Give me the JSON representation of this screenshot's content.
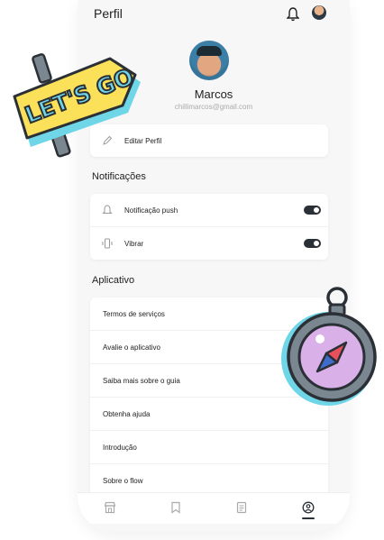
{
  "header": {
    "title": "Perfil"
  },
  "profile": {
    "name": "Marcos",
    "email": "chillimarcos@gmail.com"
  },
  "actions": {
    "edit_label": "Editar Perfil"
  },
  "notifications": {
    "section_title": "Notificações",
    "items": [
      {
        "label": "Notificação push",
        "enabled": true
      },
      {
        "label": "Vibrar",
        "enabled": true
      }
    ]
  },
  "app": {
    "section_title": "Aplicativo",
    "items": [
      {
        "label": "Termos de serviços"
      },
      {
        "label": "Avalie o aplicativo"
      },
      {
        "label": "Saiba mais sobre o guia"
      },
      {
        "label": "Obtenha ajuda"
      },
      {
        "label": "Introdução"
      },
      {
        "label": "Sobre o flow"
      }
    ]
  },
  "stickers": {
    "lets_go_text": "LET'S GO"
  },
  "nav": {
    "items": [
      "store-icon",
      "bookmark-icon",
      "document-icon",
      "profile-icon"
    ],
    "active": "profile-icon"
  },
  "colors": {
    "background": "#f7f7f8",
    "toggle": "#2b2f36",
    "sticker_yellow": "#fbe05a",
    "sticker_cyan": "#6fd6e8",
    "compass_face": "#d9b1e8"
  }
}
